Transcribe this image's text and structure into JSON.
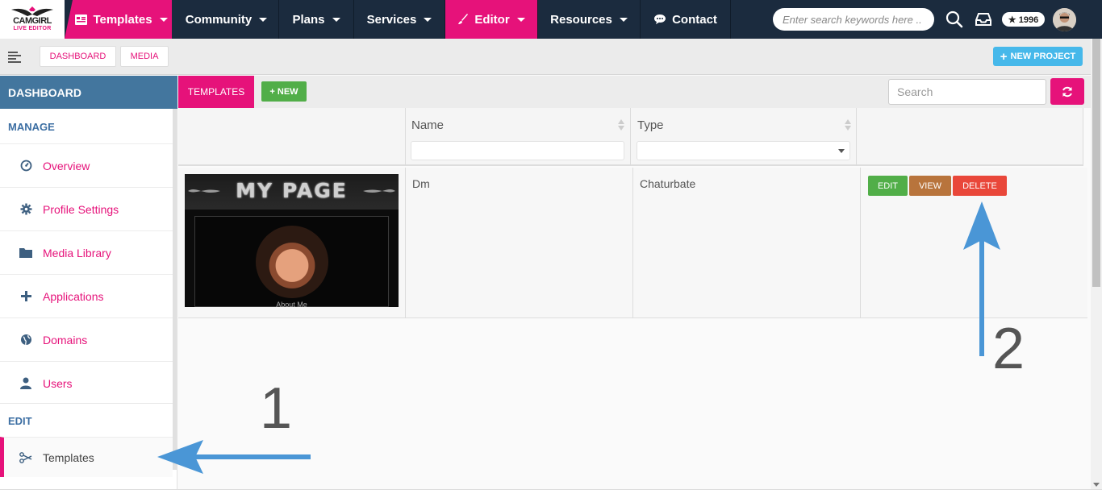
{
  "brand": {
    "name": "CAMGIRL",
    "subtitle": "LIVE EDITOR"
  },
  "topnav": {
    "templates": "Templates",
    "community": "Community",
    "plans": "Plans",
    "services": "Services",
    "editor": "Editor",
    "resources": "Resources",
    "contact": "Contact",
    "search_placeholder": "Enter search keywords here ..",
    "points": "★ 1996"
  },
  "subbar": {
    "dashboard": "DASHBOARD",
    "media": "MEDIA",
    "new_project": "NEW PROJECT"
  },
  "sidebar": {
    "header": "DASHBOARD",
    "manage_label": "MANAGE",
    "edit_label": "EDIT",
    "items": [
      {
        "label": "Overview",
        "icon": "dashboard-icon"
      },
      {
        "label": "Profile Settings",
        "icon": "gear-icon"
      },
      {
        "label": "Media Library",
        "icon": "folder-icon"
      },
      {
        "label": "Applications",
        "icon": "plus-icon"
      },
      {
        "label": "Domains",
        "icon": "globe-icon"
      },
      {
        "label": "Users",
        "icon": "user-icon"
      }
    ],
    "edit_items": [
      {
        "label": "Templates",
        "icon": "templates-icon"
      }
    ]
  },
  "panel": {
    "tab_label": "TEMPLATES",
    "new_button": "+ NEW",
    "search_placeholder": "Search",
    "columns": {
      "name": "Name",
      "type": "Type"
    },
    "rows": [
      {
        "thumbnail_title": "MY PAGE",
        "thumbnail_caption": "About Me",
        "name": "Dm",
        "type": "Chaturbate",
        "actions": {
          "edit": "EDIT",
          "view": "VIEW",
          "delete": "DELETE"
        }
      }
    ]
  },
  "annotations": {
    "step1": "1",
    "step2": "2"
  },
  "colors": {
    "nav_bg": "#1b2b3e",
    "accent_pink": "#e6127a",
    "sidebar_header": "#43769e",
    "new_green": "#51ae48",
    "view_brown": "#b8743c",
    "delete_red": "#e9473a",
    "arrow_blue": "#4a96d6",
    "project_blue": "#46b8ea"
  }
}
